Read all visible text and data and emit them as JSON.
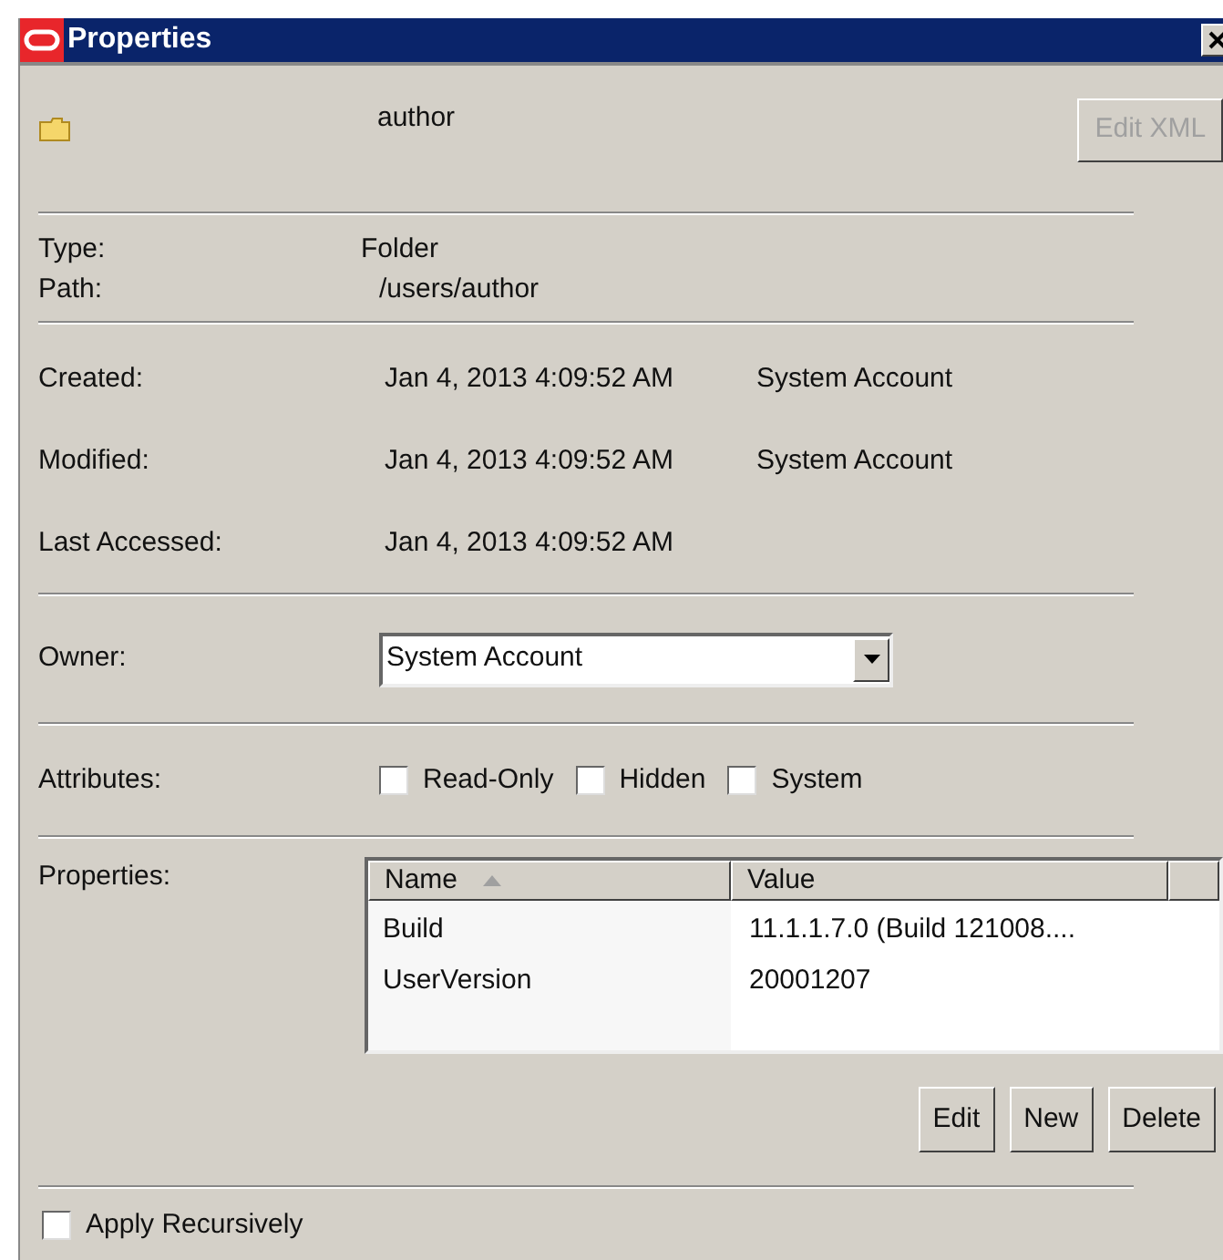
{
  "window": {
    "title": "Properties"
  },
  "name_field": {
    "value": "author"
  },
  "edit_xml_button": {
    "label": "Edit XML",
    "disabled": true
  },
  "info": [
    {
      "label": "Type:",
      "value": "Folder"
    },
    {
      "label": "Path:",
      "value": "/users/author"
    }
  ],
  "dates": [
    {
      "label": "Created:",
      "value": "Jan 4, 2013 4:09:52 AM",
      "by": "System Account"
    },
    {
      "label": "Modified:",
      "value": "Jan 4, 2013 4:09:52 AM",
      "by": "System Account"
    },
    {
      "label": "Last Accessed:",
      "value": "Jan 4, 2013 4:09:52 AM"
    }
  ],
  "owner": {
    "label": "Owner:",
    "value": "System Account"
  },
  "attributes": {
    "label": "Attributes:",
    "items": [
      {
        "label": "Read-Only",
        "checked": false
      },
      {
        "label": "Hidden",
        "checked": false
      },
      {
        "label": "System",
        "checked": false
      }
    ]
  },
  "properties": {
    "label": "Properties:",
    "columns": [
      "Name",
      "Value"
    ],
    "rows": [
      {
        "name": "Build",
        "value": "11.1.1.7.0 (Build 121008...."
      },
      {
        "name": "UserVersion",
        "value": "20001207"
      }
    ],
    "buttons": [
      "Edit",
      "New",
      "Delete"
    ]
  },
  "apply_recursively": {
    "label": "Apply Recursively",
    "checked": false
  }
}
